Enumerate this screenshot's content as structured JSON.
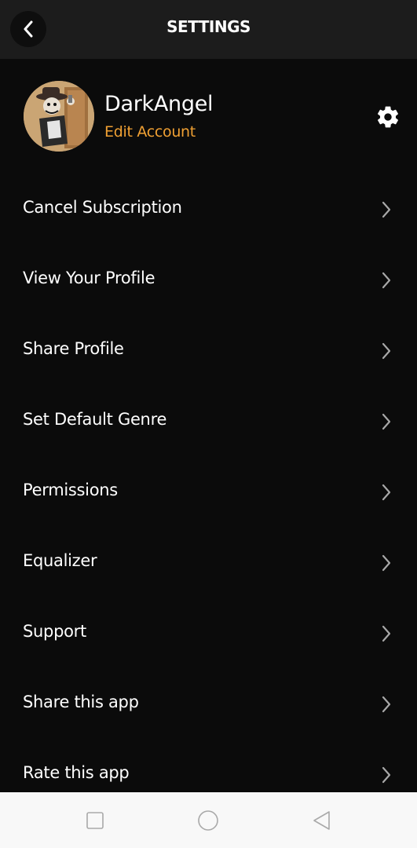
{
  "header": {
    "title": "SETTINGS",
    "back_icon": "chevron-left-icon"
  },
  "profile": {
    "username": "DarkAngel",
    "edit_label": "Edit Account",
    "avatar": "user-avatar-cartoon",
    "settings_icon": "gear-icon",
    "accent_color": "#f0a033"
  },
  "menu": {
    "items": [
      {
        "label": "Cancel Subscription"
      },
      {
        "label": "View Your Profile"
      },
      {
        "label": "Share Profile"
      },
      {
        "label": "Set Default Genre"
      },
      {
        "label": "Permissions"
      },
      {
        "label": "Equalizer"
      },
      {
        "label": "Support"
      },
      {
        "label": "Share this app"
      },
      {
        "label": "Rate this app"
      }
    ],
    "chevron_icon": "chevron-right-icon"
  },
  "system_nav": {
    "recents_icon": "square-icon",
    "home_icon": "circle-icon",
    "back_icon": "triangle-back-icon"
  }
}
